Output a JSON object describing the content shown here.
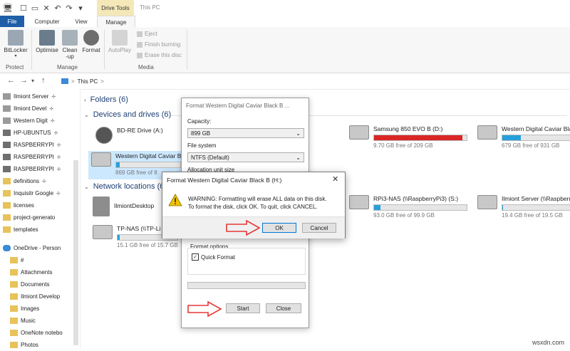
{
  "window": {
    "drive_tools_label": "Drive Tools",
    "title": "This PC"
  },
  "tabs": [
    {
      "label": "File"
    },
    {
      "label": "Computer"
    },
    {
      "label": "View"
    },
    {
      "label": "Manage"
    }
  ],
  "ribbon": {
    "bitlocker": "BitLocker",
    "optimise": "Optimise",
    "cleanup_l1": "Clean",
    "cleanup_l2": "-up",
    "format": "Format",
    "autoplay": "AutoPlay",
    "eject": "Eject",
    "finish_burning": "Finish burning",
    "erase_disc": "Erase this disc",
    "group_protect": "Protect",
    "group_manage": "Manage",
    "group_media": "Media"
  },
  "address": {
    "path": "This PC",
    "separator": ">"
  },
  "sidebar": {
    "items": [
      {
        "label": "Ilmiont Server",
        "pinned": true,
        "icon": "server-icon"
      },
      {
        "label": "Ilmiont Devel",
        "pinned": true,
        "icon": "drive-icon"
      },
      {
        "label": "Western Digit",
        "pinned": true,
        "icon": "drive-icon"
      },
      {
        "label": "HP-UBUNTUS",
        "pinned": true,
        "icon": "network-icon"
      },
      {
        "label": "RASPBERRYPI",
        "pinned": true,
        "icon": "network-icon"
      },
      {
        "label": "RASPBERRYPI",
        "pinned": true,
        "icon": "network-icon"
      },
      {
        "label": "RASPBERRYPI",
        "pinned": true,
        "icon": "network-icon"
      },
      {
        "label": "definitions",
        "pinned": true,
        "icon": "folder-icon"
      },
      {
        "label": "Inquisitr Google",
        "pinned": true,
        "icon": "folder-icon"
      },
      {
        "label": "licenses",
        "pinned": false,
        "icon": "folder-icon"
      },
      {
        "label": "project-generato",
        "pinned": false,
        "icon": "folder-icon"
      },
      {
        "label": "templates",
        "pinned": false,
        "icon": "folder-icon"
      }
    ],
    "onedrive": "OneDrive - Person",
    "onedrive_items": [
      {
        "label": "#",
        "icon": "folder-icon"
      },
      {
        "label": "Attachments",
        "icon": "folder-icon"
      },
      {
        "label": "Documents",
        "icon": "folder-icon"
      },
      {
        "label": "Ilmiont Develop",
        "icon": "folder-icon"
      },
      {
        "label": "Images",
        "icon": "folder-icon"
      },
      {
        "label": "Music",
        "icon": "folder-icon"
      },
      {
        "label": "OneNote notebo",
        "icon": "folder-icon"
      },
      {
        "label": "Photos",
        "icon": "folder-icon"
      }
    ]
  },
  "content": {
    "folders_header": "Folders (6)",
    "devices_header": "Devices and drives (6)",
    "network_header": "Network locations (6",
    "devices": [
      {
        "name": "BD-RE Drive (A:)",
        "free": "",
        "used_fraction": null
      },
      {
        "name": "Western Digital Caviar B",
        "free": "869 GB free of 8",
        "used_fraction": 0.05
      },
      {
        "name": "Samsung 850 EVO B (D:)",
        "free": "9.70 GB free of 209 GB",
        "used_fraction": 0.95
      },
      {
        "name": "Western Digital Caviar Bla",
        "free": "679 GB free of 931 GB",
        "used_fraction": 0.27
      }
    ],
    "network": [
      {
        "name": "IlmiontDesktop",
        "free": "",
        "used_fraction": null
      },
      {
        "name": "TP-NAS (\\\\TP-Li",
        "free": "15.1 GB free of 15.7 GB",
        "used_fraction": 0.04
      },
      {
        "name": "RPi3-NAS (\\\\RaspberryPi3) (S:)",
        "free": "93.0 GB free of 99.9 GB",
        "used_fraction": 0.07
      },
      {
        "name": "Ilmiont Server (\\\\Raspberry",
        "free": "19.4 GB free of 19.5 GB",
        "used_fraction": 0.01
      }
    ]
  },
  "format_dialog": {
    "title": "Format Western Digital Caviar Black B ...",
    "capacity_label": "Capacity:",
    "capacity_value": "899 GB",
    "filesystem_label": "File system",
    "filesystem_value": "NTFS (Default)",
    "allocation_label": "Allocation unit size",
    "format_options_label": "Format options",
    "quick_format_label": "Quick Format",
    "quick_format_checked": true,
    "start_label": "Start",
    "close_label": "Close"
  },
  "warning_dialog": {
    "title": "Format Western Digital Caviar Black B (H:)",
    "line1": "WARNING: Formatting will erase ALL data on this disk.",
    "line2": "To format the disk, click OK. To quit, click CANCEL.",
    "ok_label": "OK",
    "cancel_label": "Cancel"
  },
  "watermark": "wsxdn.com",
  "colors": {
    "accent": "#1f5fa8",
    "drive_tools": "#f5e8b8",
    "bar_fill": "#26a0da",
    "bar_full": "#da2626",
    "arrow": "#e53935"
  }
}
